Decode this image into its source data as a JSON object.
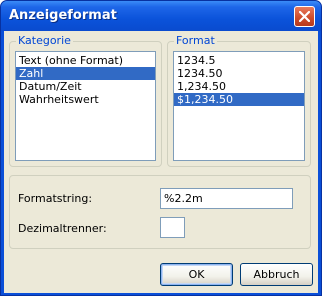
{
  "window": {
    "title": "Anzeigeformat"
  },
  "kategorie": {
    "label": "Kategorie",
    "items": [
      "Text (ohne Format)",
      "Zahl",
      "Datum/Zeit",
      "Wahrheitswert"
    ],
    "selected_index": 1
  },
  "format": {
    "label": "Format",
    "items": [
      "1234.5",
      "1234.50",
      "1,234.50",
      "$1,234.50"
    ],
    "selected_index": 3
  },
  "fields": {
    "formatstring_label": "Formatstring:",
    "formatstring_value": "%2.2m",
    "dezimaltrenner_label": "Dezimaltrenner:",
    "dezimaltrenner_value": ""
  },
  "buttons": {
    "ok": "OK",
    "cancel": "Abbruch"
  },
  "colors": {
    "titlebar": "#0b53da",
    "selection": "#316ac5",
    "group_label": "#0046d5",
    "close_button": "#cc4a2a"
  },
  "icons": {
    "close": "close-icon"
  }
}
